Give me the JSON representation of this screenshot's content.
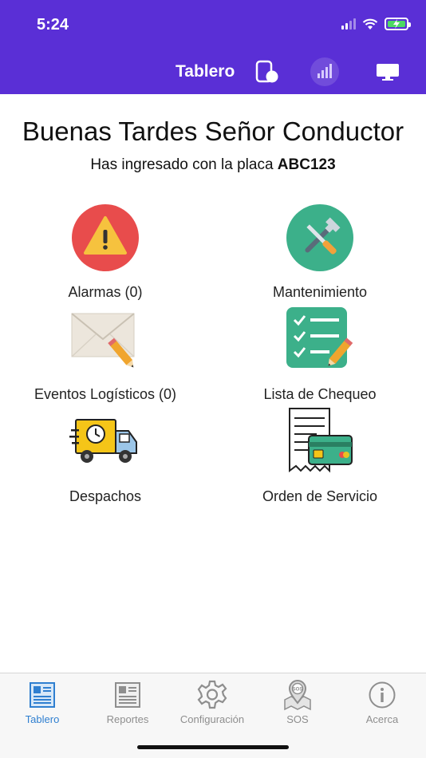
{
  "status_bar": {
    "time": "5:24"
  },
  "nav": {
    "title": "Tablero"
  },
  "greeting": {
    "title": "Buenas Tardes Señor Conductor",
    "plate_prefix": "Has ingresado con la placa",
    "plate": "ABC123"
  },
  "tiles": [
    {
      "label": "Alarmas (0)",
      "icon": "warning-icon"
    },
    {
      "label": "Mantenimiento",
      "icon": "tools-icon"
    },
    {
      "label": "Eventos Logísticos (0)",
      "icon": "envelope-icon"
    },
    {
      "label": "Lista de Chequeo",
      "icon": "checklist-icon"
    },
    {
      "label": "Despachos",
      "icon": "delivery-truck-icon"
    },
    {
      "label": "Orden de Servicio",
      "icon": "receipt-card-icon"
    }
  ],
  "tabbar": {
    "items": [
      {
        "label": "Tablero",
        "active": true
      },
      {
        "label": "Reportes",
        "active": false
      },
      {
        "label": "Configuración",
        "active": false
      },
      {
        "label": "SOS",
        "active": false
      },
      {
        "label": "Acerca",
        "active": false
      }
    ]
  },
  "colors": {
    "header": "#5a2fd6",
    "active_tab": "#2f7fd0",
    "inactive_tab": "#8e8e8e"
  }
}
